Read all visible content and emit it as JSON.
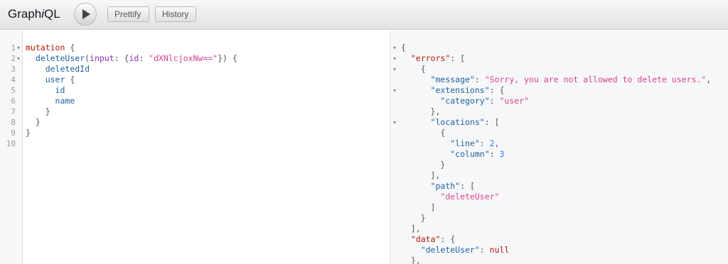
{
  "app": {
    "title_prefix": "Graph",
    "title_italic": "i",
    "title_suffix": "QL"
  },
  "toolbar": {
    "run_label": "Execute Query",
    "prettify_label": "Prettify",
    "history_label": "History"
  },
  "editor": {
    "line_numbers": [
      "1",
      "2",
      "3",
      "4",
      "5",
      "6",
      "7",
      "8",
      "9",
      "10"
    ],
    "query": {
      "mutation_kw": "mutation",
      "field": "deleteUser",
      "arg_name": "input",
      "arg_key": "id",
      "arg_value": "\"dXNlcjoxNw==\"",
      "field_deleted_id": "deletedId",
      "field_user": "user",
      "field_id": "id",
      "field_name": "name"
    }
  },
  "result": {
    "errors_key": "\"errors\"",
    "message_key": "\"message\"",
    "message_value": "\"Sorry, you are not allowed to delete users.\"",
    "extensions_key": "\"extensions\"",
    "category_key": "\"category\"",
    "category_value": "\"user\"",
    "locations_key": "\"locations\"",
    "line_key": "\"line\"",
    "line_value": "2",
    "column_key": "\"column\"",
    "column_value": "3",
    "path_key": "\"path\"",
    "path_value": "\"deleteUser\"",
    "data_key": "\"data\"",
    "delete_user_key": "\"deleteUser\"",
    "delete_user_value": "null"
  },
  "icons": {
    "run": "play-icon",
    "fold": "fold-arrow-icon"
  }
}
